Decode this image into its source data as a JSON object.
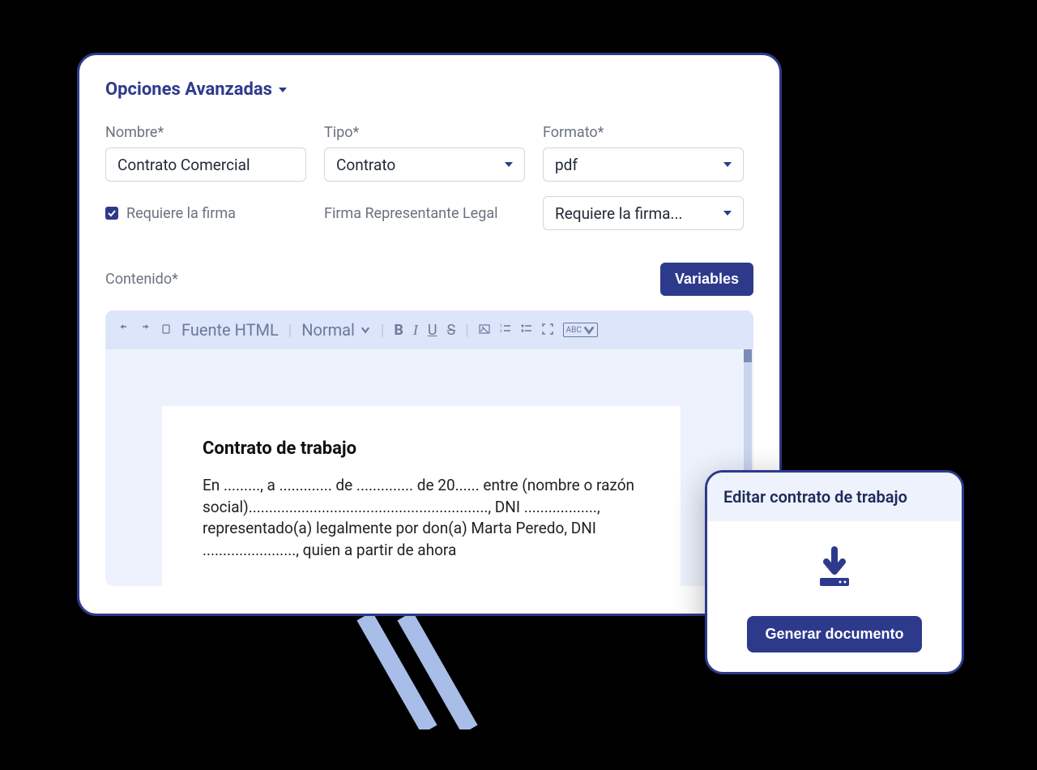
{
  "section_title": "Opciones Avanzadas",
  "fields": {
    "nombre": {
      "label": "Nombre*",
      "value": "Contrato Comercial"
    },
    "tipo": {
      "label": "Tipo*",
      "value": "Contrato"
    },
    "formato": {
      "label": "Formato*",
      "value": "pdf"
    }
  },
  "checkbox": {
    "label": "Requiere la firma",
    "checked": true
  },
  "firma_rep_label": "Firma Representante Legal",
  "firma_select": "Requiere la firma...",
  "contenido_label": "Contenido*",
  "variables_btn": "Variables",
  "toolbar": {
    "source": "Fuente HTML",
    "normal": "Normal",
    "abc": "ABC"
  },
  "document": {
    "title": "Contrato de trabajo",
    "body": "En ........., a ............. de .............. de 20...... entre (nombre o razón social)..........................................................., DNI .................., representado(a) legalmente por don(a) Marta Peredo, DNI ......................., quien a partir de ahora"
  },
  "popup": {
    "title": "Editar contrato de trabajo",
    "button": "Generar documento"
  }
}
